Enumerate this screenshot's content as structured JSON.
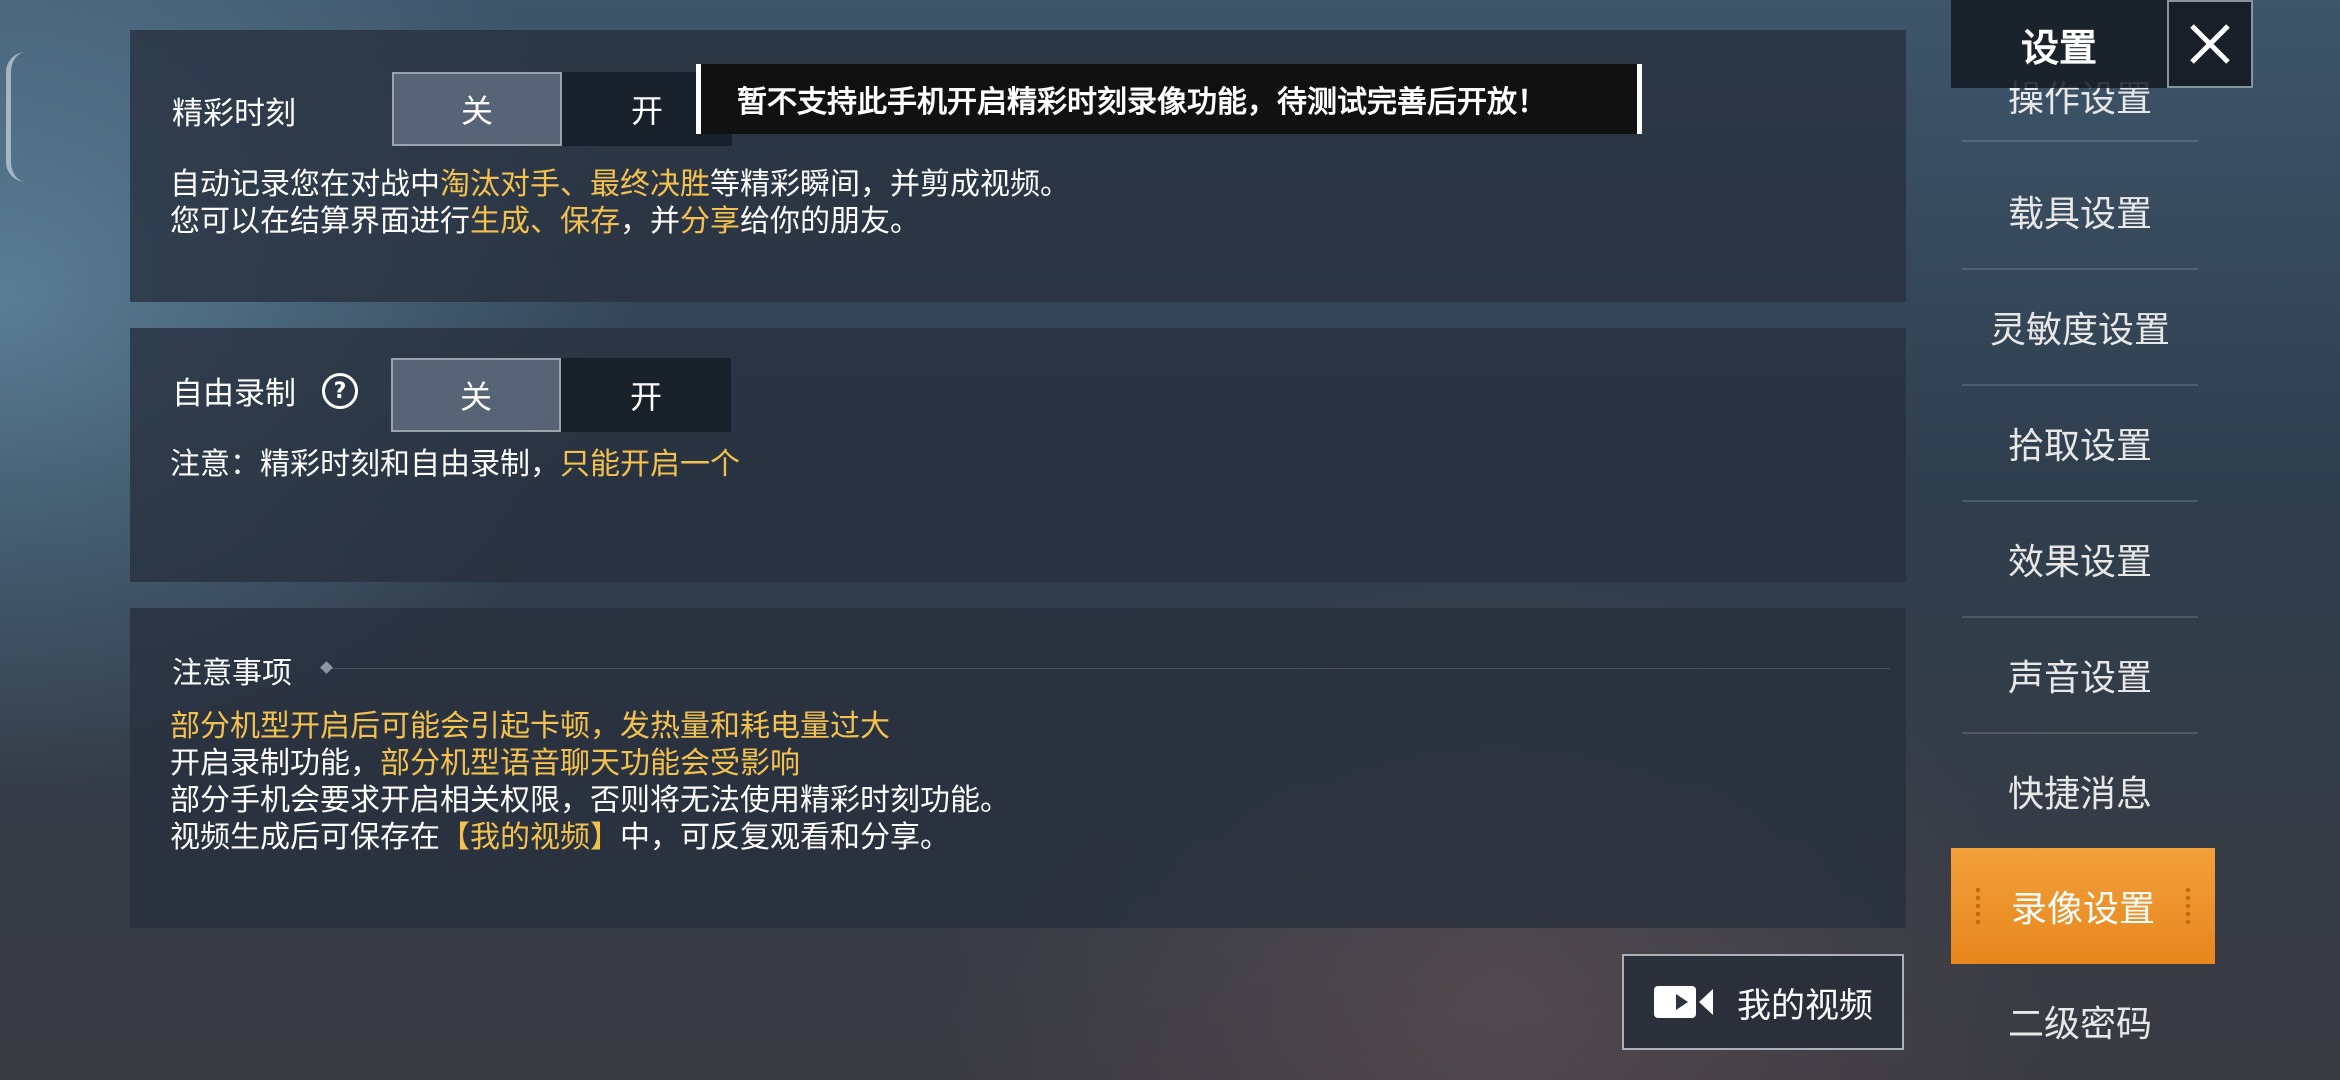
{
  "highlight": {
    "label": "精彩时刻",
    "off": "关",
    "on": "开",
    "line1": {
      "a": "自动记录您在对战中",
      "b": "淘汰对手、最终决胜",
      "c": "等精彩瞬间，并剪成视频。"
    },
    "line2": {
      "a": "您可以在结算界面进行",
      "b": "生成、保存",
      "c": "，并",
      "d": "分享",
      "e": "给你的朋友。"
    },
    "tooltip": "暂不支持此手机开启精彩时刻录像功能，待测试完善后开放！"
  },
  "free": {
    "label": "自由录制",
    "help": "?",
    "off": "关",
    "on": "开",
    "note": {
      "a": "注意：精彩时刻和自由录制，",
      "b": "只能开启一个"
    }
  },
  "notes": {
    "title": "注意事项",
    "line1": "部分机型开启后可能会引起卡顿，发热量和耗电量过大",
    "line2": {
      "a": "开启录制功能，",
      "b": "部分机型语音聊天功能会受影响"
    },
    "line3": "部分手机会要求开启相关权限，否则将无法使用精彩时刻功能。",
    "line4": {
      "a": "视频生成后可保存在",
      "b": "【我的视频】",
      "c": "中，可反复观看和分享。"
    }
  },
  "sidebar": {
    "title": "设置",
    "items": [
      {
        "label": "操作设置"
      },
      {
        "label": "载具设置"
      },
      {
        "label": "灵敏度设置"
      },
      {
        "label": "拾取设置"
      },
      {
        "label": "效果设置"
      },
      {
        "label": "声音设置"
      },
      {
        "label": "快捷消息"
      },
      {
        "label": "录像设置"
      },
      {
        "label": "二级密码"
      }
    ],
    "active_index": 7
  },
  "my_video_button": "我的视频",
  "colors": {
    "highlight": "#f2c14e",
    "accent": "#e7861d"
  }
}
